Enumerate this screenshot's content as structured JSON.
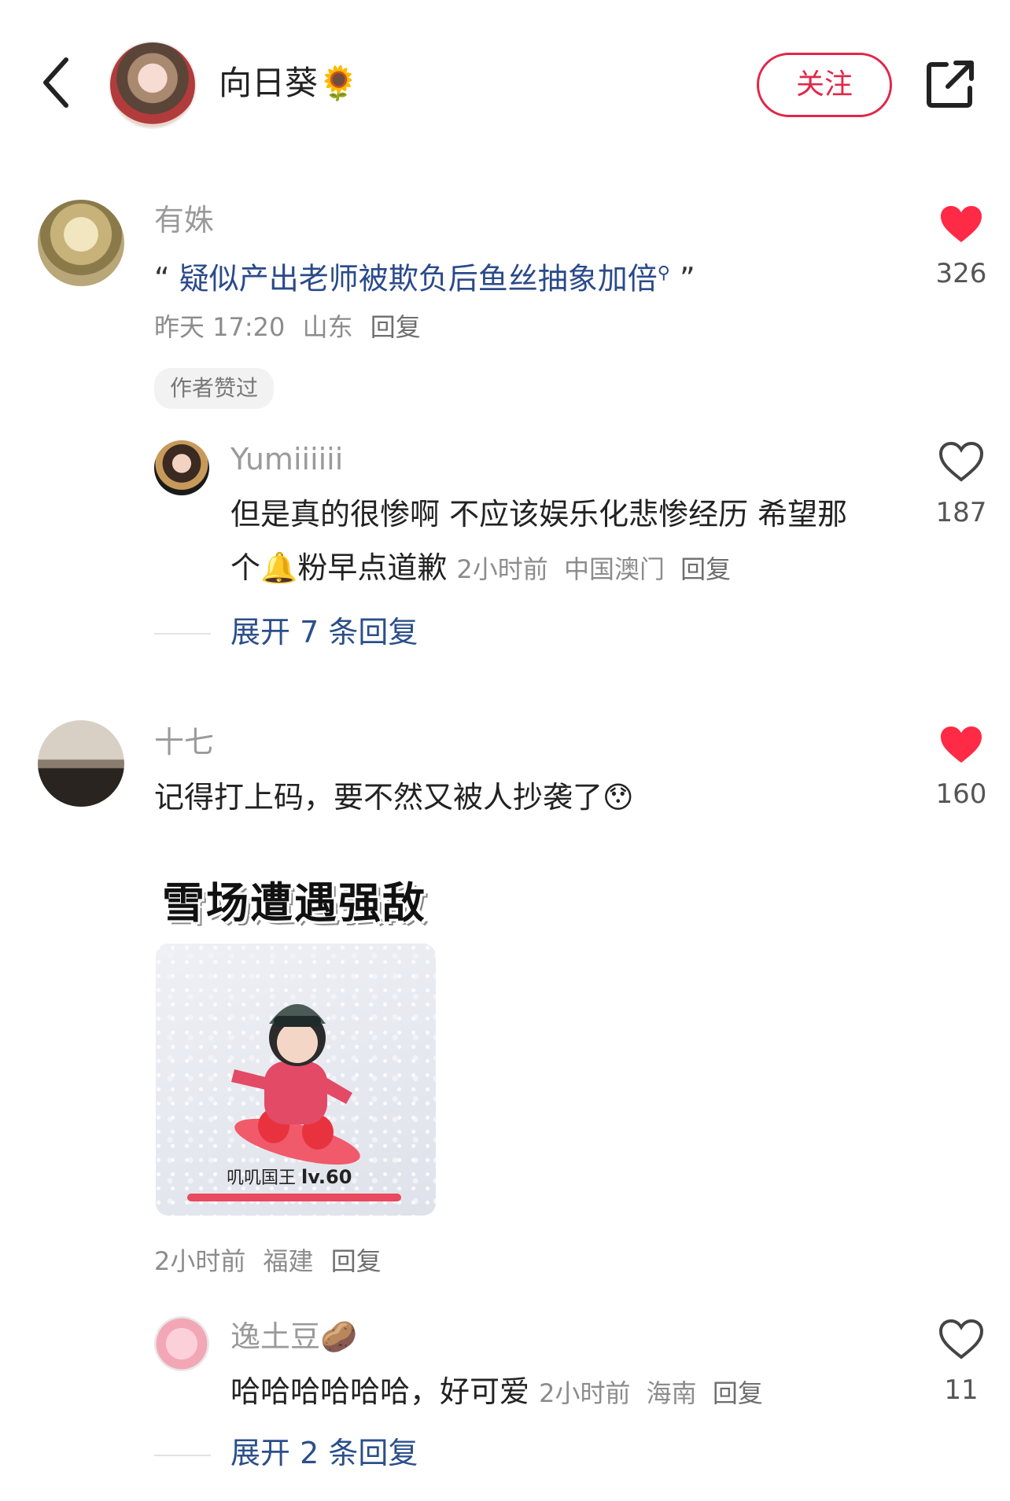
{
  "header": {
    "owner_name": "向日葵🌻",
    "follow_label": "关注",
    "icons": [
      "back-icon",
      "share-icon"
    ]
  },
  "comments": [
    {
      "username": "有姝",
      "quote_open": "“",
      "quote_text": "疑似产出老师被欺负后鱼丝抽象加倍",
      "quote_close": "”",
      "time": "昨天 17:20",
      "location": "山东",
      "reply_label": "回复",
      "badge": "作者赞过",
      "likes": "326",
      "liked": true,
      "sub_reply": {
        "username": "Yumiiiiii",
        "text": "但是真的很惨啊 不应该娱乐化悲惨经历 希望那个🔔粉早点道歉",
        "time": "2小时前",
        "location": "中国澳门",
        "reply_label": "回复",
        "likes": "187",
        "liked": false
      },
      "expand_label": "展开 7 条回复"
    },
    {
      "username": "十七",
      "text": "记得打上码，要不然又被人抄袭了😯",
      "sticker_title": "雪场遭遇强敌",
      "sticker_caption": "叽叽国王",
      "sticker_level": "lv.60",
      "time": "2小时前",
      "location": "福建",
      "reply_label": "回复",
      "likes": "160",
      "liked": true,
      "sub_reply": {
        "username": "逸土豆🥔",
        "text": "哈哈哈哈哈哈，好可爱",
        "time": "2小时前",
        "location": "海南",
        "reply_label": "回复",
        "likes": "11",
        "liked": false
      },
      "expand_label": "展开 2 条回复"
    }
  ],
  "colors": {
    "accent": "#e0284a",
    "link": "#2b4f8a",
    "like_filled": "#ff2a45"
  }
}
